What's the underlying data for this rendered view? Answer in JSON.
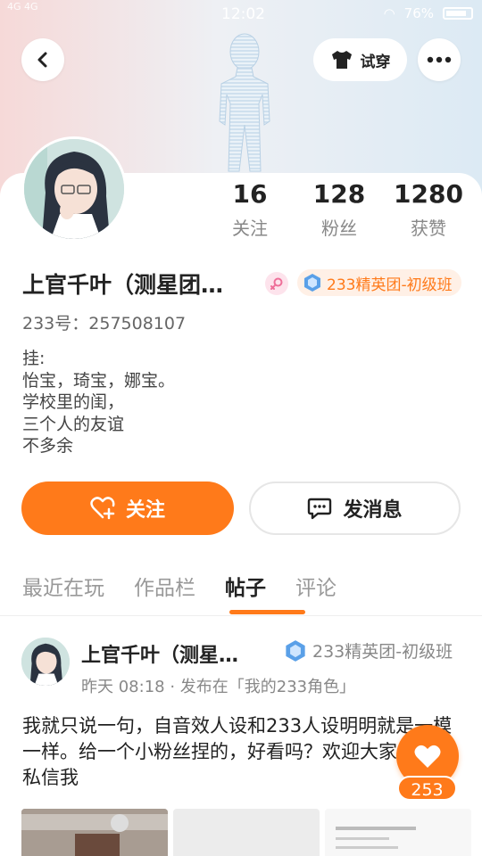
{
  "status_bar": {
    "left": "4G 4G",
    "time": "12:02",
    "battery": "76%"
  },
  "header": {
    "try_on_label": "试穿"
  },
  "profile": {
    "stats": [
      {
        "value": "16",
        "label": "关注"
      },
      {
        "value": "128",
        "label": "粉丝"
      },
      {
        "value": "1280",
        "label": "获赞"
      }
    ],
    "name": "上官千叶（测星团…",
    "rank": "233精英团-初级班",
    "uid": "233号：257508107",
    "bio": "挂:\n怡宝，琦宝，娜宝。\n学校里的闺，\n三个人的友谊\n不多余"
  },
  "actions": {
    "follow_label": "关注",
    "message_label": "发消息"
  },
  "tabs": [
    {
      "label": "最近在玩"
    },
    {
      "label": "作品栏"
    },
    {
      "label": "帖子"
    },
    {
      "label": "评论"
    }
  ],
  "post": {
    "author": "上官千叶（测星…",
    "rank": "233精英团-初级班",
    "meta": "昨天 08:18 · 发布在「我的233角色」",
    "body": "我就只说一句，自音效人设和233人设明明就是一模一样。给一个小粉丝捏的，好看吗？欢迎大家投稿，私信我"
  },
  "like": {
    "count": "253"
  },
  "colors": {
    "accent": "#ff7a1a"
  }
}
